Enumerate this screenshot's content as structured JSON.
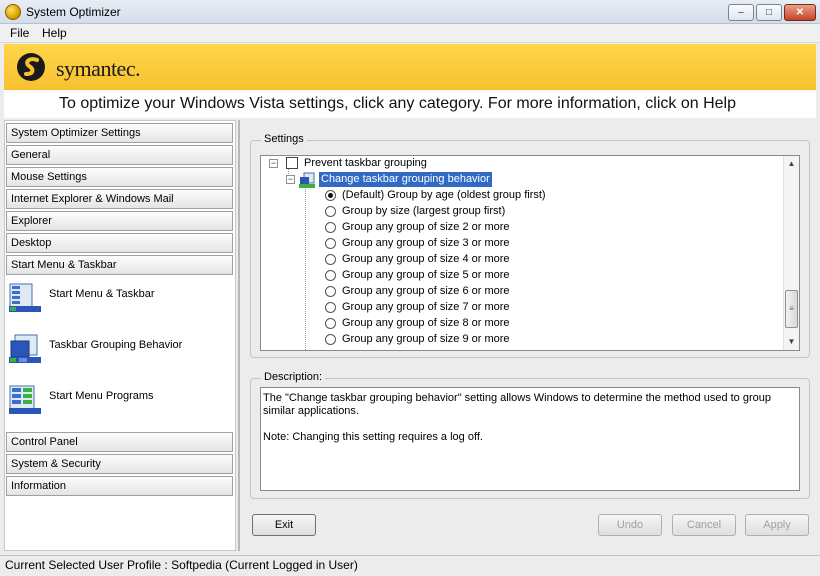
{
  "window": {
    "title": "System Optimizer",
    "icon": "symantec-app-icon"
  },
  "menu": {
    "file": "File",
    "help": "Help"
  },
  "banner": {
    "logo_text": "symantec.",
    "brand_color": "#f7c12e"
  },
  "instruction": "To optimize your Windows Vista settings, click any category. For more information, click on Help",
  "categories_top": [
    "System Optimizer Settings",
    "General",
    "Mouse Settings",
    "Internet Explorer & Windows Mail",
    "Explorer",
    "Desktop",
    "Start Menu & Taskbar"
  ],
  "subitems": [
    {
      "label": "Start Menu & Taskbar",
      "icon": "start-menu-icon"
    },
    {
      "label": "Taskbar Grouping Behavior",
      "icon": "taskbar-grouping-icon"
    },
    {
      "label": "Start Menu Programs",
      "icon": "start-menu-programs-icon"
    }
  ],
  "categories_bottom": [
    "Control Panel",
    "System & Security",
    "Information"
  ],
  "settings": {
    "legend": "Settings",
    "parent_item": {
      "label": "Prevent taskbar grouping",
      "checked": false
    },
    "selected_item": "Change taskbar grouping behavior",
    "options": [
      {
        "label": "(Default) Group by age (oldest group first)",
        "selected": true
      },
      {
        "label": "Group by size (largest group first)",
        "selected": false
      },
      {
        "label": "Group any group of size 2 or more",
        "selected": false
      },
      {
        "label": "Group any group of size 3 or more",
        "selected": false
      },
      {
        "label": "Group any group of size 4 or more",
        "selected": false
      },
      {
        "label": "Group any group of size 5 or more",
        "selected": false
      },
      {
        "label": "Group any group of size 6 or more",
        "selected": false
      },
      {
        "label": "Group any group of size 7 or more",
        "selected": false
      },
      {
        "label": "Group any group of size 8 or more",
        "selected": false
      },
      {
        "label": "Group any group of size 9 or more",
        "selected": false
      }
    ]
  },
  "description": {
    "legend": "Description:",
    "text1": "The \"Change taskbar grouping behavior\" setting allows Windows to determine the method used to group similar applications.",
    "text2": "Note: Changing this setting requires a log off."
  },
  "buttons": {
    "exit": "Exit",
    "undo": "Undo",
    "cancel": "Cancel",
    "apply": "Apply"
  },
  "status": "Current Selected User Profile :  Softpedia (Current Logged in User)"
}
